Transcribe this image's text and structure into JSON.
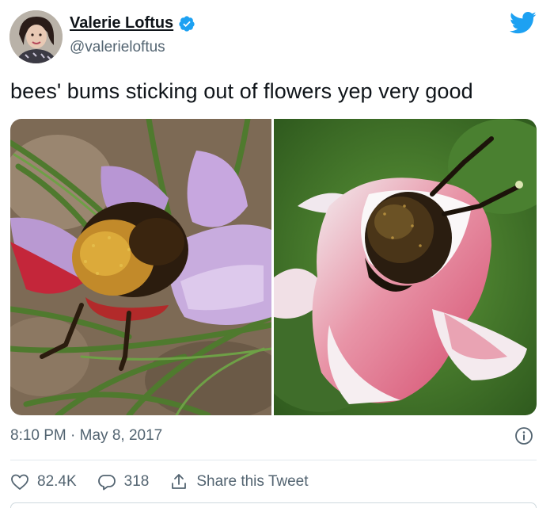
{
  "author": {
    "display_name": "Valerie Loftus",
    "handle": "@valerieloftus",
    "verified": true
  },
  "tweet": {
    "text": "bees' bums sticking out of flowers yep very good",
    "timestamp": "8:10 PM · May 8, 2017"
  },
  "media": {
    "images": [
      {
        "description_icon": "bee-in-purple-crocus-photo"
      },
      {
        "description_icon": "bee-in-pink-flower-photo"
      }
    ]
  },
  "actions": {
    "likes": "82.4K",
    "replies": "318",
    "share_label": "Share this Tweet"
  },
  "colors": {
    "accent": "#1da1f2",
    "text": "#0f1419",
    "secondary_text": "#536471"
  },
  "icons": [
    "twitter-bird-icon",
    "verified-badge-icon",
    "info-icon",
    "heart-icon",
    "reply-icon",
    "share-icon"
  ]
}
